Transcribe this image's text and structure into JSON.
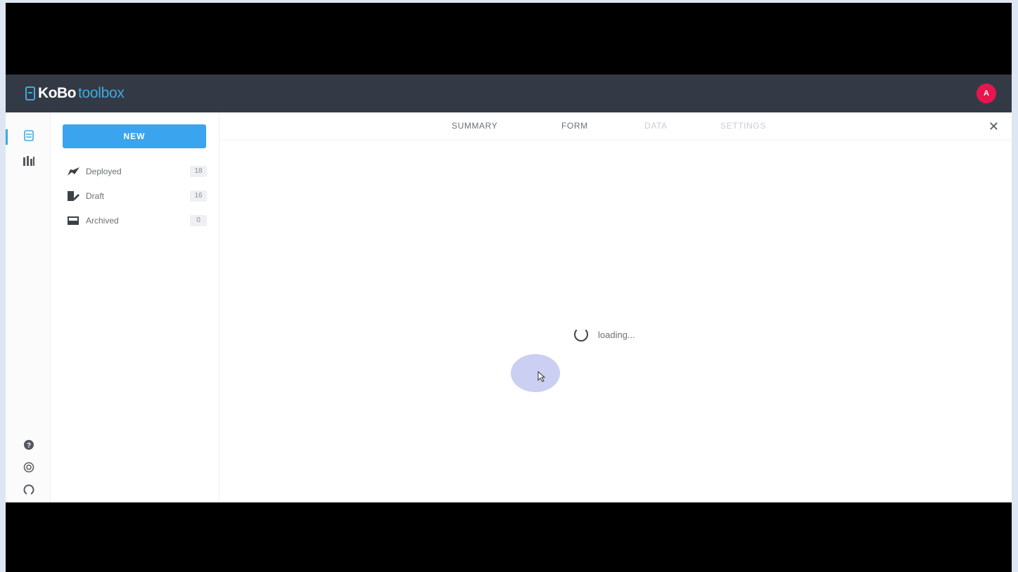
{
  "header": {
    "logo_kobo": "KoBo",
    "logo_toolbox": "toolbox",
    "avatar_initial": "A",
    "avatar_color": "#e8154f",
    "bar_color": "#333a45",
    "accent_color": "#41a9e1"
  },
  "iconbar": {
    "top_icons": [
      "projects-icon",
      "library-icon"
    ],
    "bottom_icons": [
      "help-icon",
      "support-icon",
      "github-icon"
    ]
  },
  "sidebar": {
    "new_label": "NEW",
    "items": [
      {
        "icon": "rocket-icon",
        "label": "Deployed",
        "count": "18"
      },
      {
        "icon": "draft-icon",
        "label": "Draft",
        "count": "16"
      },
      {
        "icon": "archive-icon",
        "label": "Archived",
        "count": "0"
      }
    ]
  },
  "tabs": [
    {
      "label": "SUMMARY",
      "enabled": true
    },
    {
      "label": "FORM",
      "enabled": true
    },
    {
      "label": "DATA",
      "enabled": false
    },
    {
      "label": "SETTINGS",
      "enabled": false
    }
  ],
  "close_icon": "close-icon",
  "loading": {
    "text": "loading..."
  }
}
